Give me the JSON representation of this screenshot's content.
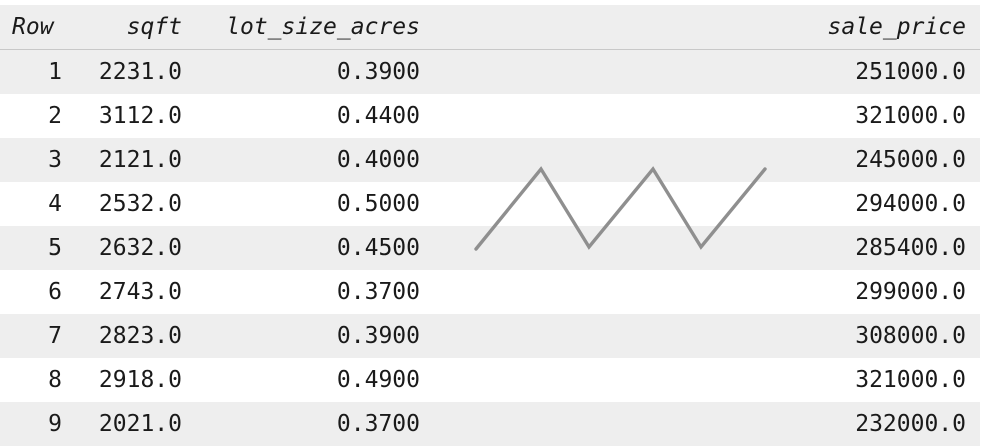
{
  "columns": {
    "row": "Row",
    "sqft": "sqft",
    "lot_size_acres": "lot_size_acres",
    "sale_price": "sale_price"
  },
  "rows": [
    {
      "row": "1",
      "sqft": "2231.0",
      "lot_size_acres": "0.3900",
      "sale_price": "251000.0"
    },
    {
      "row": "2",
      "sqft": "3112.0",
      "lot_size_acres": "0.4400",
      "sale_price": "321000.0"
    },
    {
      "row": "3",
      "sqft": "2121.0",
      "lot_size_acres": "0.4000",
      "sale_price": "245000.0"
    },
    {
      "row": "4",
      "sqft": "2532.0",
      "lot_size_acres": "0.5000",
      "sale_price": "294000.0"
    },
    {
      "row": "5",
      "sqft": "2632.0",
      "lot_size_acres": "0.4500",
      "sale_price": "285400.0"
    },
    {
      "row": "6",
      "sqft": "2743.0",
      "lot_size_acres": "0.3700",
      "sale_price": "299000.0"
    },
    {
      "row": "7",
      "sqft": "2823.0",
      "lot_size_acres": "0.3900",
      "sale_price": "308000.0"
    },
    {
      "row": "8",
      "sqft": "2918.0",
      "lot_size_acres": "0.4900",
      "sale_price": "321000.0"
    },
    {
      "row": "9",
      "sqft": "2021.0",
      "lot_size_acres": "0.3700",
      "sale_price": "232000.0"
    }
  ],
  "colors": {
    "header_bg": "#eeeeee",
    "stripe_bg": "#eeeeee",
    "text": "#1a1a1a",
    "truncation_mark": "#8f8f8f"
  },
  "icons": {
    "truncation": "zigzag-truncation-icon"
  }
}
